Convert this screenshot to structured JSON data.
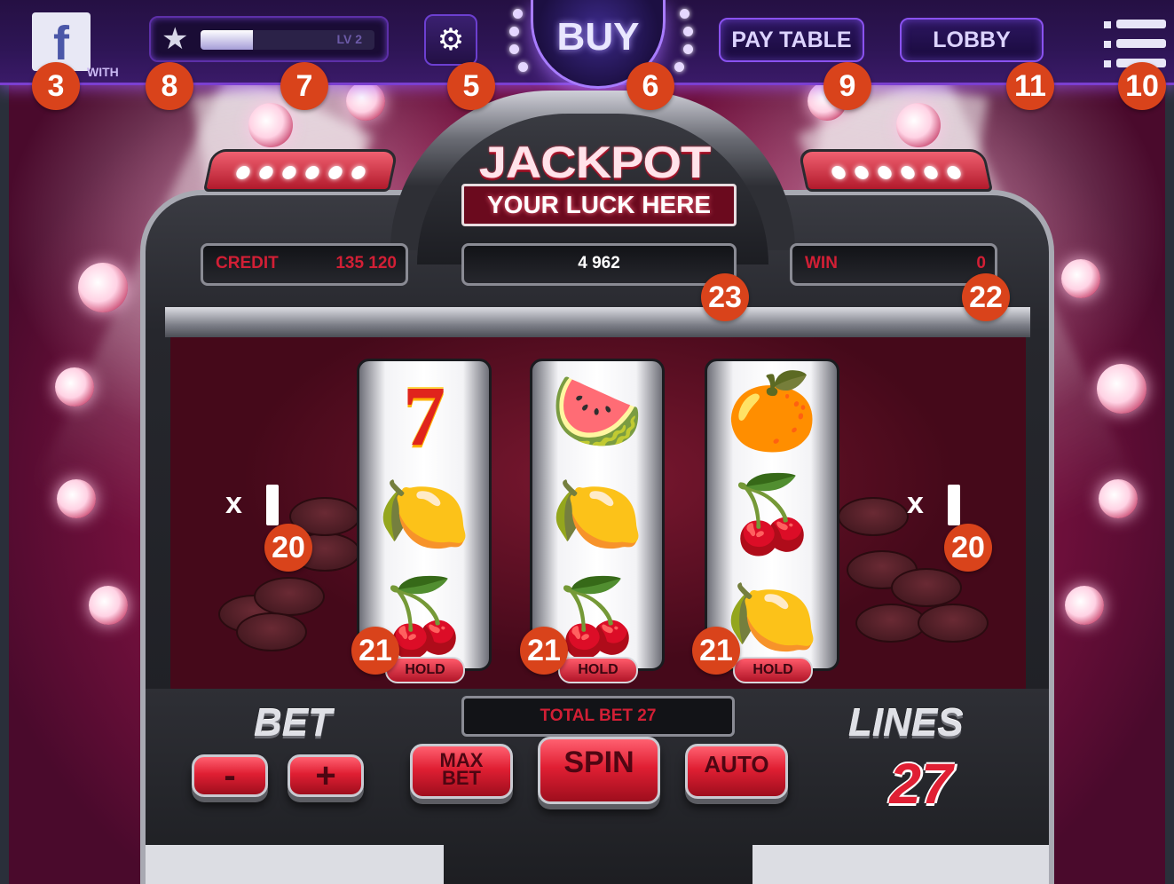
{
  "topbar": {
    "facebook_glyph": "f",
    "facebook_with": "WITH",
    "xp_level": "LV 2",
    "xp_progress_fraction": 0.3,
    "buy_label": "BUY",
    "pay_table_label": "PAY TABLE",
    "lobby_label": "LOBBY"
  },
  "machine": {
    "jackpot_title": "JACKPOT",
    "jackpot_subtitle": "YOUR LUCK HERE",
    "credit_label": "CREDIT",
    "credit_value": "135 120",
    "jackpot_amount": "4 962",
    "win_label": "WIN",
    "win_value": "0",
    "multiplier_prefix": "x"
  },
  "reels": [
    {
      "symbols": [
        "seven",
        "lemon",
        "cherry"
      ],
      "hold_label": "HOLD"
    },
    {
      "symbols": [
        "watermelon",
        "lemon",
        "cherry"
      ],
      "hold_label": "HOLD"
    },
    {
      "symbols": [
        "orange",
        "cherry",
        "lemon"
      ],
      "hold_label": "HOLD"
    }
  ],
  "controls": {
    "bet_label": "BET",
    "minus_label": "-",
    "plus_label": "+",
    "total_bet": "TOTAL BET 27",
    "max_bet_line1": "MAX",
    "max_bet_line2": "BET",
    "spin_label": "SPIN",
    "auto_label": "AUTO",
    "lines_label": "LINES",
    "lines_value": "27"
  },
  "callouts": {
    "facebook": "3",
    "xp_star": "8",
    "xp_bar": "7",
    "settings": "5",
    "buy": "6",
    "pay_table": "9",
    "lobby": "11",
    "menu": "10",
    "jackpot_amount": "23",
    "win": "22",
    "multiplier_left": "20",
    "multiplier_right": "20",
    "hold_1": "21",
    "hold_2": "21",
    "hold_3": "21"
  },
  "icons": {
    "star": "star-icon",
    "settings": "gear-icon",
    "menu": "hamburger-menu-icon",
    "facebook": "facebook-icon"
  },
  "colors": {
    "accent_purple": "#8a52f0",
    "machine_red": "#e01f33",
    "callout_orange": "#d9431b",
    "stage_pink": "#c2185b"
  }
}
